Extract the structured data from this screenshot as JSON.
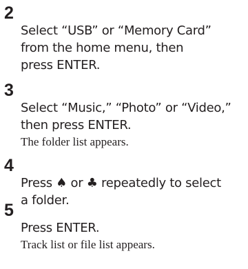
{
  "steps": [
    {
      "number": "2",
      "text": "Select “USB” or “Memory Card”\nfrom the home menu, then\npress ENTER.",
      "result": ""
    },
    {
      "number": "3",
      "text": "Select “Music,” “Photo” or “Video,”\nthen press ENTER.",
      "result": "The folder list appears."
    },
    {
      "number": "4",
      "text": "Press ♠ or ♣ repeatedly to select\na folder.",
      "result": ""
    },
    {
      "number": "5",
      "text": "Press ENTER.",
      "result": "Track list or file list appears."
    }
  ]
}
